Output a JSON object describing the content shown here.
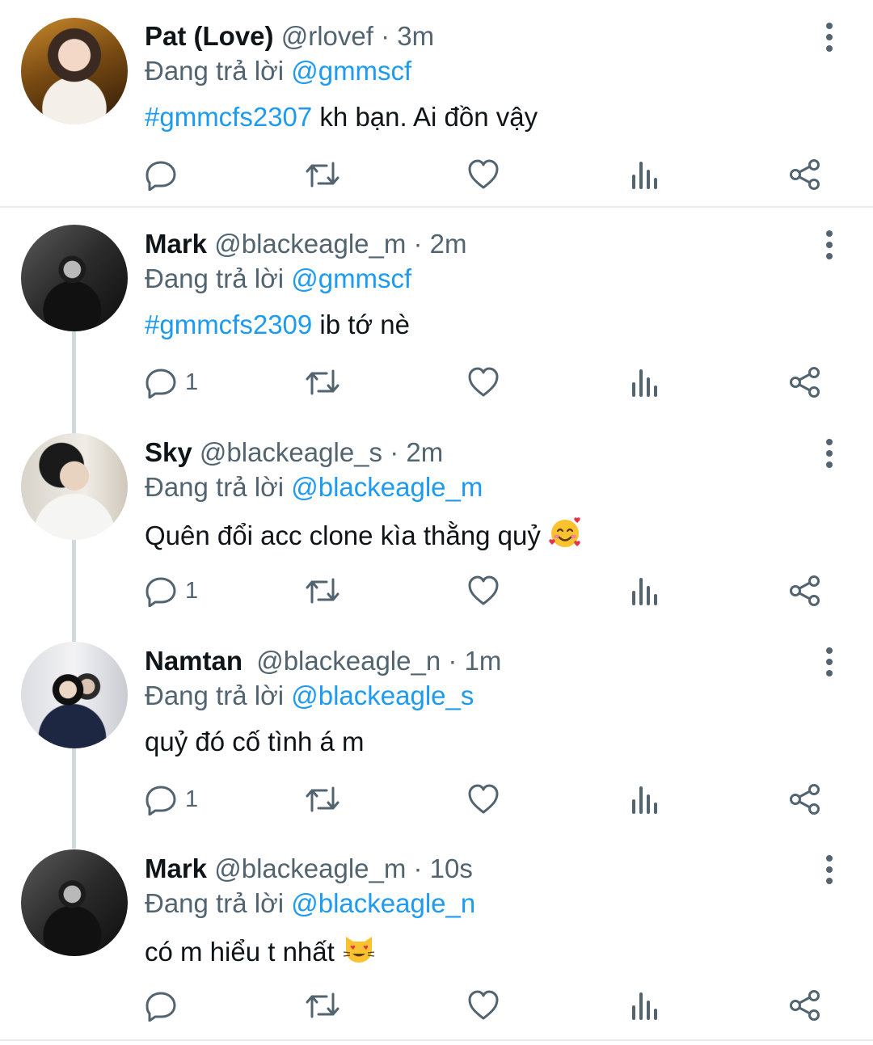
{
  "tweets": [
    {
      "name": "Pat (Love)",
      "handle": "@rlovef",
      "time": "· 3m",
      "reply_prefix": "Đang trả lời",
      "reply_to": "@gmmscf",
      "hashtag": "#gmmcfs2307",
      "text": " kh bạn. Ai đồn vậy",
      "reply_count": ""
    },
    {
      "name": "Mark",
      "handle": "@blackeagle_m",
      "time": "· 2m",
      "reply_prefix": "Đang trả lời",
      "reply_to": "@gmmscf",
      "hashtag": "#gmmcfs2309",
      "text": " ib tớ nè",
      "reply_count": "1"
    },
    {
      "name": "Sky",
      "handle": "@blackeagle_s",
      "time": "· 2m",
      "reply_prefix": "Đang trả lời",
      "reply_to": "@blackeagle_m",
      "hashtag": "",
      "text": "Quên đổi acc clone kìa thằng quỷ",
      "emoji": "smiling-face-with-hearts",
      "reply_count": "1"
    },
    {
      "name": "Namtan",
      "handle": "@blackeagle_n",
      "time": "· 1m",
      "reply_prefix": "Đang trả lời",
      "reply_to": "@blackeagle_s",
      "hashtag": "",
      "text": "quỷ đó cố tình á m",
      "reply_count": "1"
    },
    {
      "name": "Mark",
      "handle": "@blackeagle_m",
      "time": "· 10s",
      "reply_prefix": "Đang trả lời",
      "reply_to": "@blackeagle_n",
      "hashtag": "",
      "text": "có m hiểu t nhất",
      "emoji": "heart-eyes-cat",
      "reply_count": ""
    }
  ],
  "icons": [
    "reply-icon",
    "retweet-icon",
    "like-icon",
    "views-icon",
    "share-icon",
    "more-icon"
  ],
  "colors": {
    "accent": "#1d9bf0",
    "muted": "#536471",
    "text": "#0f1419",
    "thread_line": "#cfd9de"
  }
}
